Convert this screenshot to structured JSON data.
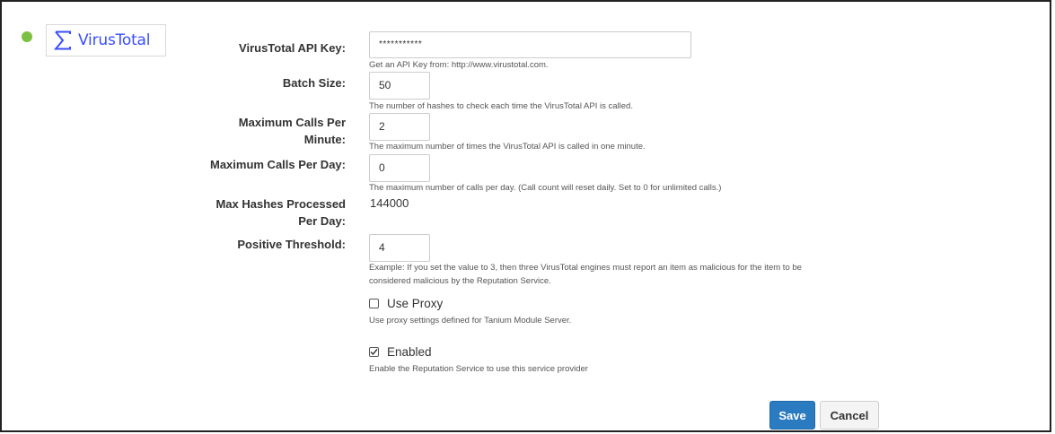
{
  "provider": {
    "name": "VirusTotal",
    "logo_text": "VirusTotal",
    "status_color": "#7bc043",
    "brand_color": "#394eff"
  },
  "fields": {
    "api_key": {
      "label": "VirusTotal API Key:",
      "value": "***********",
      "help": "Get an API Key from: http://www.virustotal.com."
    },
    "batch_size": {
      "label": "Batch Size:",
      "value": "50",
      "help": "The number of hashes to check each time the VirusTotal API is called."
    },
    "max_calls_per_minute": {
      "label_line1": "Maximum Calls Per",
      "label_line2": "Minute:",
      "value": "2",
      "help": "The maximum number of times the VirusTotal API is called in one minute."
    },
    "max_calls_per_day": {
      "label": "Maximum Calls Per Day:",
      "value": "0",
      "help": "The maximum number of calls per day. (Call count will reset daily. Set to 0 for unlimited calls.)"
    },
    "max_hashes_per_day": {
      "label_line1": "Max Hashes Processed",
      "label_line2": "Per Day:",
      "value": "144000"
    },
    "positive_threshold": {
      "label": "Positive Threshold:",
      "value": "4",
      "help_line1": "Example: If you set the value to 3, then three VirusTotal engines must report an item as malicious for the item to be",
      "help_line2": "considered malicious by the Reputation Service."
    }
  },
  "use_proxy": {
    "label": "Use Proxy",
    "checked": false,
    "help": "Use proxy settings defined for Tanium Module Server."
  },
  "enabled": {
    "label": "Enabled",
    "checked": true,
    "help": "Enable the Reputation Service to use this service provider"
  },
  "actions": {
    "save_label": "Save",
    "cancel_label": "Cancel"
  }
}
